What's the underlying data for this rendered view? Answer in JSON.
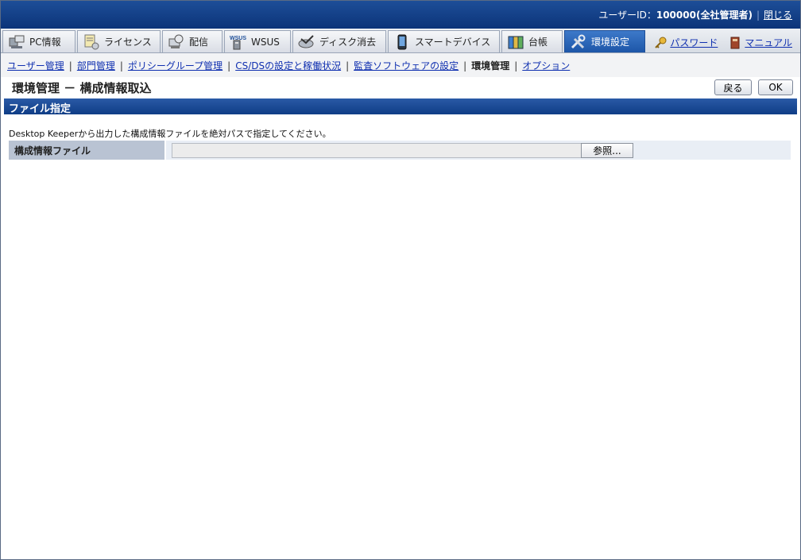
{
  "header": {
    "user_label": "ユーザーID：",
    "user_id": "100000(全社管理者)",
    "close_link": "閉じる"
  },
  "tabs": [
    {
      "label": "PC情報",
      "icon": "pc-icon"
    },
    {
      "label": "ライセンス",
      "icon": "license-icon"
    },
    {
      "label": "配信",
      "icon": "distribution-icon"
    },
    {
      "label": "WSUS",
      "icon": "wsus-icon"
    },
    {
      "label": "ディスク消去",
      "icon": "disk-erase-icon"
    },
    {
      "label": "スマートデバイス",
      "icon": "smart-device-icon"
    },
    {
      "label": "台帳",
      "icon": "ledger-icon"
    },
    {
      "label": "環境設定",
      "icon": "settings-tools-icon"
    }
  ],
  "top_links": {
    "password": "パスワード",
    "manual": "マニュアル"
  },
  "subnav": {
    "items": [
      "ユーザー管理",
      "部門管理",
      "ポリシーグループ管理",
      "CS/DSの設定と稼働状況",
      "監査ソフトウェアの設定",
      "環境管理",
      "オプション"
    ]
  },
  "page": {
    "title": "環境管理 － 構成情報取込",
    "back_button": "戻る",
    "ok_button": "OK",
    "section_title": "ファイル指定",
    "description": "Desktop Keeperから出力した構成情報ファイルを絶対パスで指定してください。",
    "field_label": "構成情報ファイル",
    "file_value": "",
    "browse_button": "参照..."
  },
  "colors": {
    "header_bg": "#0c3479",
    "active_tab": "#1d56a8",
    "section_bg": "#0f3d86",
    "link": "#1030b0"
  }
}
